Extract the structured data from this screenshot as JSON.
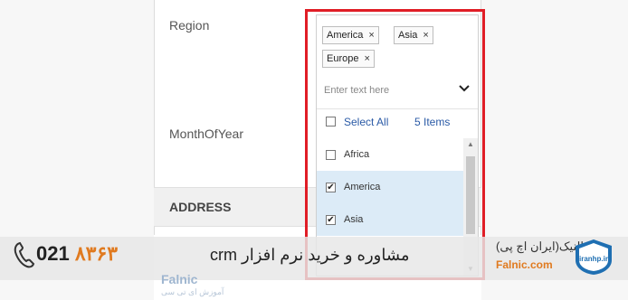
{
  "form": {
    "region_label": "Region",
    "month_label": "MonthOfYear",
    "address_section": "ADDRESS"
  },
  "multiselect": {
    "tags": [
      {
        "label": "America",
        "remove": "×"
      },
      {
        "label": "Asia",
        "remove": "×"
      },
      {
        "label": "Europe",
        "remove": "×"
      }
    ],
    "placeholder": "Enter text here",
    "select_all_label": "Select All",
    "items_count": "5 Items",
    "options": [
      {
        "label": "Africa",
        "checked": false
      },
      {
        "label": "America",
        "checked": true
      },
      {
        "label": "Asia",
        "checked": true
      }
    ],
    "icons": {
      "toggle": "chevron-down-icon",
      "scroll_up": "scroll-up-arrow-icon",
      "scroll_down": "scroll-down-arrow-icon"
    }
  },
  "banner": {
    "text": "مشاوره و خرید نرم افزار crm",
    "phone_prefix": "021",
    "phone_number": "۸۳۶۳",
    "brand_name": "فالنیک(ایران اچ پی)",
    "brand_url": "Falnic.com",
    "logo_text": "iranhp.ir",
    "watermark": "Falnic",
    "watermark_sub": "آموزش ای تی سی"
  },
  "colors": {
    "highlight_box": "#e01d26",
    "link": "#2a5aa6",
    "selected_row": "#dcebf7",
    "accent": "#e07a1f"
  }
}
